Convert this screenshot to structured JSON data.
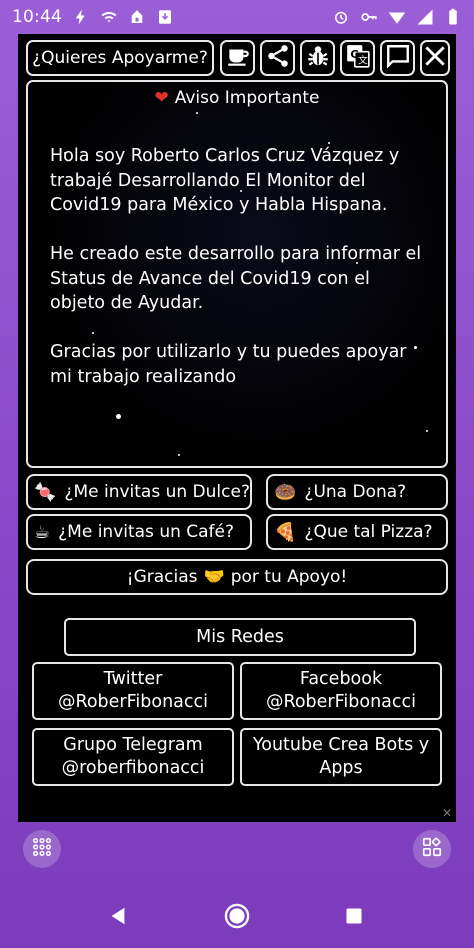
{
  "status_bar": {
    "time": "10:44",
    "left_icons": [
      "flash-icon",
      "wifi-icon",
      "notification-icon",
      "download-icon"
    ],
    "right_icons": [
      "alarm-icon",
      "key-icon",
      "signal-icon",
      "signal-bars-icon",
      "battery-icon"
    ]
  },
  "toolbar": {
    "support_label": "¿Quieres Apoyarme?",
    "icons": [
      "coffee-icon",
      "share-icon",
      "bug-icon",
      "translate-icon",
      "chat-icon",
      "close-icon"
    ]
  },
  "notice": {
    "title_emoji": "❤",
    "title": "Aviso Importante",
    "paragraphs": [
      "Hola soy Roberto Carlos Cruz Vázquez y trabajé Desarrollando El Monitor del Covid19 para México y Habla Hispana.",
      "He creado este desarrollo para informar el Status de Avance del Covid19 con el objeto de Ayudar.",
      "Gracias por utilizarlo y tu puedes apoyar mi trabajo realizando"
    ]
  },
  "donations": [
    {
      "emoji": "🍬",
      "label": "¿Me invitas un Dulce?"
    },
    {
      "emoji": "🍩",
      "label": "¿Una Dona?"
    },
    {
      "emoji": "☕",
      "label": "¿Me invitas un Café?"
    },
    {
      "emoji": "🍕",
      "label": "¿Que tal Pizza?"
    }
  ],
  "thanks": {
    "before": "¡Gracias",
    "emoji": "🤝",
    "after": "por tu Apoyo!"
  },
  "redes": {
    "title": "Mis Redes",
    "items": [
      "Twitter\n@RoberFibonacci",
      "Facebook\n@RoberFibonacci",
      "Grupo Telegram\n@roberfibonacci",
      "Youtube Crea Bots y\nApps"
    ]
  },
  "ad_close": "✕",
  "fabs": [
    "apps-grid-icon",
    "widgets-icon"
  ],
  "nav": [
    "back-icon",
    "home-icon",
    "recents-icon"
  ]
}
